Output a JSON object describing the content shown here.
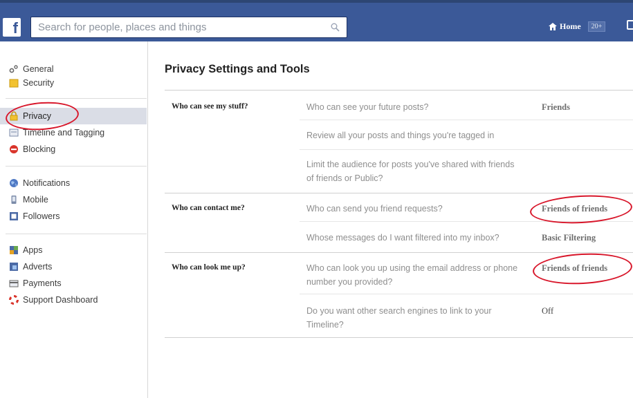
{
  "topbar": {
    "logo_letter": "f",
    "search_placeholder": "Search for people, places and things",
    "home_label": "Home",
    "home_count": "20+"
  },
  "sidebar": {
    "groups": [
      {
        "items": [
          {
            "label": "General",
            "icon": "gears-icon"
          },
          {
            "label": "Security",
            "icon": "security-badge-icon"
          }
        ]
      },
      {
        "items": [
          {
            "label": "Privacy",
            "icon": "lock-icon",
            "active": true
          },
          {
            "label": "Timeline and Tagging",
            "icon": "timeline-icon"
          },
          {
            "label": "Blocking",
            "icon": "blocking-icon"
          }
        ]
      },
      {
        "items": [
          {
            "label": "Notifications",
            "icon": "globe-icon"
          },
          {
            "label": "Mobile",
            "icon": "mobile-icon"
          },
          {
            "label": "Followers",
            "icon": "rss-icon"
          }
        ]
      },
      {
        "items": [
          {
            "label": "Apps",
            "icon": "apps-icon"
          },
          {
            "label": "Adverts",
            "icon": "adverts-icon"
          },
          {
            "label": "Payments",
            "icon": "payment-card-icon"
          },
          {
            "label": "Support Dashboard",
            "icon": "lifebuoy-icon"
          }
        ]
      }
    ]
  },
  "main": {
    "title": "Privacy Settings and Tools",
    "sections": [
      {
        "label": "Who can see my stuff?",
        "rows": [
          {
            "question": "Who can see your future posts?",
            "value": "Friends"
          },
          {
            "question": "Review all your posts and things you're tagged in",
            "value": ""
          },
          {
            "question": "Limit the audience for posts you've shared with friends of friends or Public?",
            "value": ""
          }
        ]
      },
      {
        "label": "Who can contact me?",
        "rows": [
          {
            "question": "Who can send you friend requests?",
            "value": "Friends of friends"
          },
          {
            "question": "Whose messages do I want filtered into my inbox?",
            "value": "Basic Filtering"
          }
        ]
      },
      {
        "label": "Who can look me up?",
        "rows": [
          {
            "question": "Who can look you up using the email address or phone number you provided?",
            "value": "Friends of friends"
          },
          {
            "question": "Do you want other search engines to link to your Timeline?",
            "value": "Off"
          }
        ]
      }
    ]
  },
  "colors": {
    "topbar": "#3b5998",
    "annotation_circle": "#d8162a",
    "active_item_bg": "#dadde6"
  }
}
